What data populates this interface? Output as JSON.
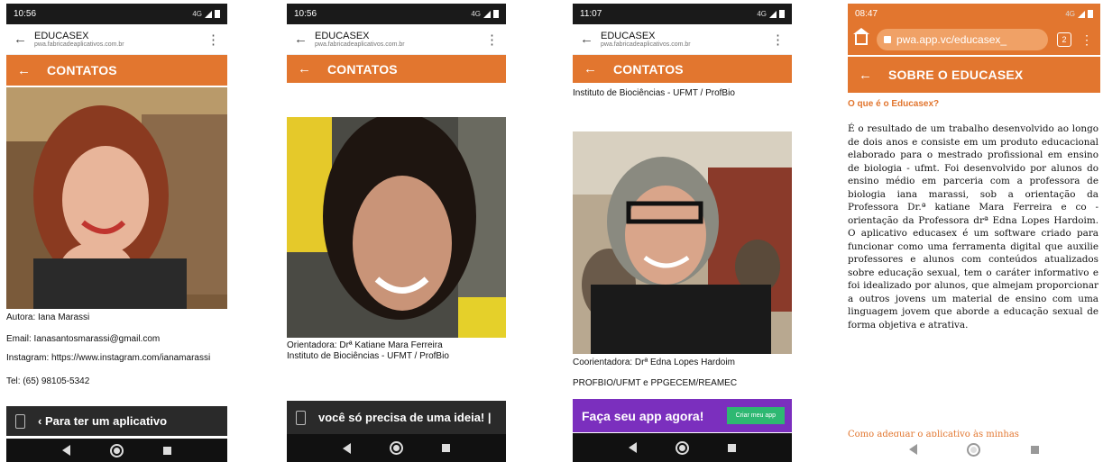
{
  "screens": [
    {
      "time": "10:56",
      "net": "4G",
      "browser_title": "EDUCASEX",
      "browser_url": "pwa.fabricadeaplicativos.com.br",
      "appbar_title": "CONTATOS",
      "lines": [
        "Autora: Iana Marassi",
        "Email: Ianasantosmarassi@gmail.com",
        "Instagram: https://www.instagram.com/ianamarassi",
        "Tel: (65) 98105-5342"
      ],
      "banner_text": "‹ Para ter um aplicativo"
    },
    {
      "time": "10:56",
      "net": "4G",
      "browser_title": "EDUCASEX",
      "browser_url": "pwa.fabricadeaplicativos.com.br",
      "appbar_title": "CONTATOS",
      "lines": [
        "Orientadora: Drª Katiane Mara Ferreira",
        "Instituto de Biociências - UFMT / ProfBio"
      ],
      "banner_text": "você só precisa de uma ideia! |"
    },
    {
      "time": "11:07",
      "net": "4G",
      "browser_title": "EDUCASEX",
      "browser_url": "pwa.fabricadeaplicativos.com.br",
      "appbar_title": "CONTATOS",
      "top_line": "Instituto de Biociências - UFMT / ProfBio",
      "lines": [
        "Coorientadora: Drª Edna Lopes Hardoim",
        "PROFBIO/UFMT e PPGECEM/REAMEC"
      ],
      "banner_text": "Faça seu app agora!",
      "banner_button": "Criar meu app"
    },
    {
      "time": "08:47",
      "net": "4G",
      "url": "pwa.app.vc/educasex_",
      "tab_count": "2",
      "appbar_title": "SOBRE O EDUCASEX",
      "subtitle": "O que é o Educasex?",
      "paragraph": "É o resultado de um trabalho desenvolvido ao longo de dois anos e consiste em um produto educacional elaborado para o mestrado profissional em ensino de biologia - ufmt. Foi desenvolvido por alunos do ensino médio em parceria com a professora de biologia iana marassi, sob a orientação da Professora Dr.ª katiane Mara Ferreira e co - orientação da Professora drª Edna Lopes Hardoim. O aplicativo educasex é um software criado para funcionar como uma ferramenta digital que auxilie professores e alunos com conteúdos atualizados sobre educação sexual, tem o caráter informativo e foi idealizado por alunos, que almejam proporcionar a outros jovens um material de ensino com uma linguagem jovem que aborde a educação sexual de forma objetiva e atrativa.",
      "next_heading": "Como adequar o aplicativo às minhas"
    }
  ],
  "colors": {
    "accent": "#e2762f",
    "purple_banner": "#7b2fbe",
    "green_button": "#2eb872",
    "dark_banner": "#2a2a2a"
  }
}
